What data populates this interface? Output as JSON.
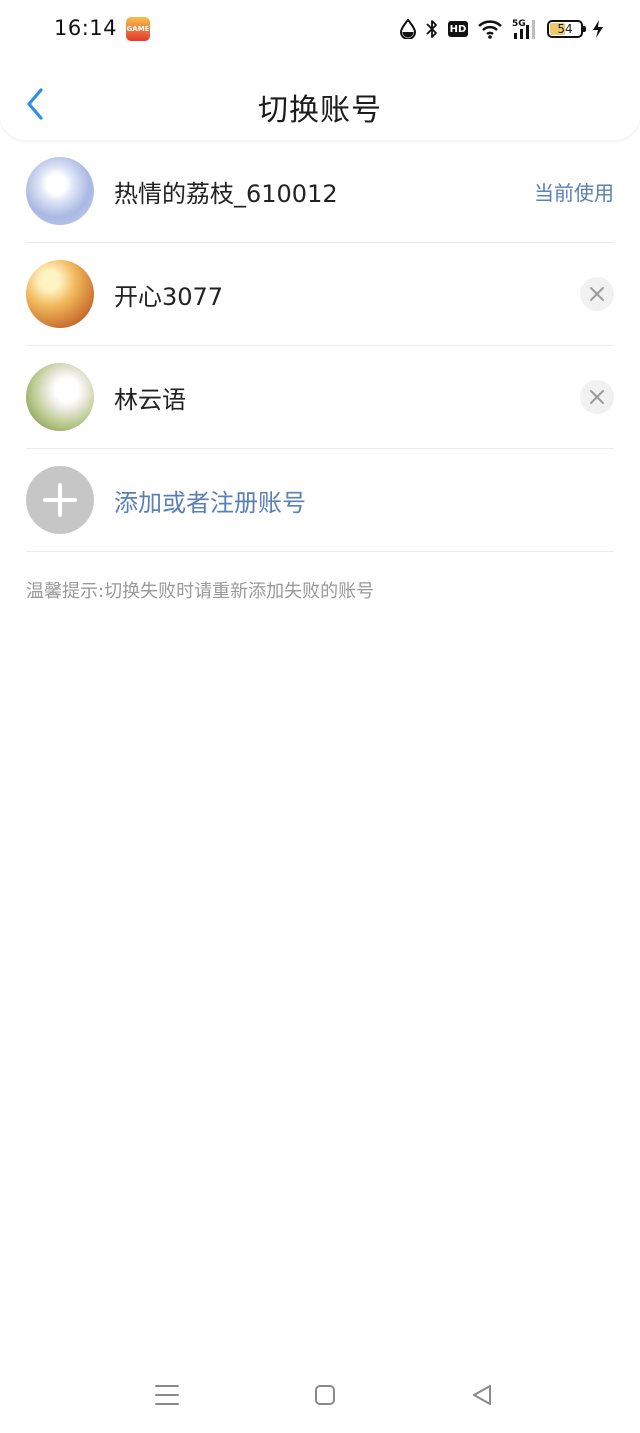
{
  "status_bar": {
    "time": "16:14",
    "app_icon": "game-app-icon",
    "network": "5G",
    "hd": "HD",
    "battery": "54",
    "battery_level": 0.54,
    "icons": [
      "data-saver-icon",
      "bluetooth-icon",
      "hd-icon",
      "wifi-icon",
      "signal-5g-icon",
      "battery-icon",
      "charging-icon"
    ]
  },
  "header": {
    "back_icon": "chevron-left-icon",
    "title": "切换账号"
  },
  "accounts": [
    {
      "name": "热情的荔枝_610012",
      "status": "当前使用",
      "avatar": "anime-avatar-white-hair"
    },
    {
      "name": "开心3077",
      "action_icon": "close-icon",
      "avatar": "anime-avatar-orange-hair"
    },
    {
      "name": "林云语",
      "action_icon": "close-icon",
      "avatar": "anime-avatar-cat-ears"
    }
  ],
  "add_account": {
    "label": "添加或者注册账号",
    "icon": "plus-icon"
  },
  "tip": "温馨提示:切换失败时请重新添加失败的账号",
  "nav_bar": {
    "icons": [
      "menu-icon",
      "home-icon",
      "back-triangle-icon"
    ]
  },
  "colors": {
    "accent_blue": "#5a80b8",
    "back_arrow": "#2f8fe6",
    "divider": "#ececec",
    "tip_text": "#9a9a9a",
    "add_circle": "#c6c6c6"
  }
}
